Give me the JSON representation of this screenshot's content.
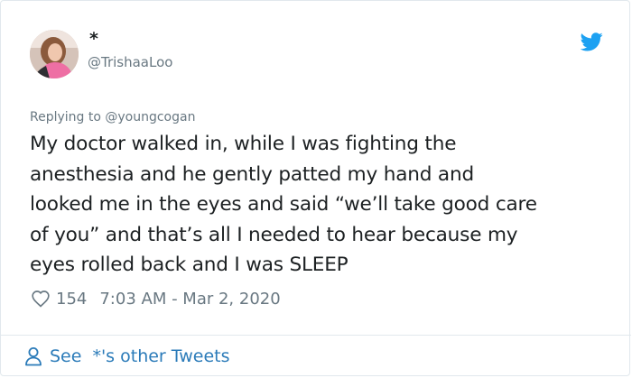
{
  "tweet": {
    "display_name": "*",
    "handle": "@TrishaaLoo",
    "reply_context": "Replying to @youngcogan",
    "text": "My doctor walked in, while I was fighting the\nanesthesia and he gently patted my hand and\nlooked me in the eyes and said “we’ll take good care\nof you” and that’s all I needed to hear because my\neyes rolled back and I was SLEEP",
    "likes": "154",
    "timestamp": "7:03 AM - Mar 2, 2020"
  },
  "footer": {
    "see_label": "See",
    "other_tweets_label": "*'s other Tweets"
  },
  "icons": {
    "brand": "twitter-bird-icon",
    "like": "heart-icon",
    "profile": "person-icon"
  },
  "colors": {
    "brand_blue": "#1da1f2",
    "link_blue": "#2b7bb9",
    "muted_text": "#697882",
    "main_text": "#1c2022",
    "border": "#e1e8ed"
  }
}
